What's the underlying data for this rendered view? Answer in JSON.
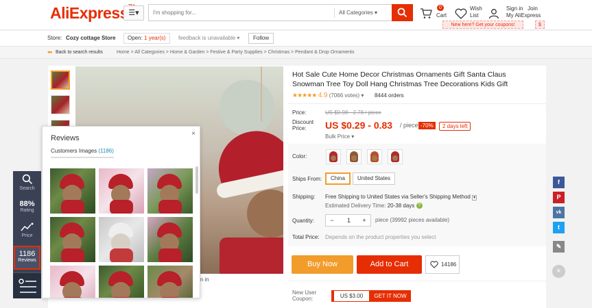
{
  "header": {
    "logo": "AliExpress",
    "logo_tm": "TM",
    "search_placeholder": "I'm shopping for...",
    "search_category": "All Categories",
    "cart_count": "0",
    "cart_label": "Cart",
    "wish_line1": "Wish",
    "wish_line2": "List",
    "signin_line1": "Sign in",
    "signin_line2": "My AliExpress",
    "join": "Join",
    "coupon_tip": "New here? Get your coupons!",
    "coupon_dollar": "$"
  },
  "store": {
    "label": "Store:",
    "name": "Cozy cottage Store",
    "open_label": "Open:",
    "open_value": "1 year(s)",
    "feedback": "feedback is unavailable",
    "follow": "Follow"
  },
  "breadcrumb": {
    "back": "Back to search results",
    "path": "Home > All Categories > Home & Garden > Festive & Party Supplies > Christmas > Pendant & Drop Ornaments"
  },
  "product": {
    "title": "Hot Sale Cute Home Decor Christmas Ornaments Gift Santa Claus Snowman Tree Toy Doll Hang Christmas Tree Decorations Kids Gift",
    "stars": "★★★★★",
    "score": "4.9",
    "votes": "(7066 votes)",
    "orders": "8444 orders",
    "price_label": "Price:",
    "old_price": "US $0.98 - 2.78 / piece",
    "discount_label": "Discount Price:",
    "discount_price": "US $0.29 - 0.83",
    "per_piece": "/ piece",
    "pct_off": "-70%",
    "days_left": "2 days left",
    "bulk_price": "Bulk Price",
    "color_label": "Color:",
    "ships_label": "Ships From:",
    "ships_options": [
      "China",
      "United States"
    ],
    "shipping_label": "Shipping:",
    "shipping_text": "Free Shipping to United States via Seller's Shipping Method",
    "delivery_label": "Estimated Delivery Time:",
    "delivery_value": "20-38 days",
    "quantity_label": "Quantity:",
    "quantity_value": "1",
    "quantity_minus": "−",
    "quantity_plus": "+",
    "quantity_hint": "piece (39992 pieces available)",
    "total_label": "Total Price:",
    "total_hint": "Depends on the product properties you select",
    "buy_now": "Buy Now",
    "add_to_cart": "Add to Cart",
    "wish_count": "14186",
    "new_user_label": "New User Coupon:",
    "coupon_value": "US $3.00",
    "coupon_get": "GET IT NOW",
    "image_caption": "om in"
  },
  "reviews_popup": {
    "title": "Reviews",
    "close": "×",
    "tab_label": "Customers Images",
    "tab_count": "(1186)"
  },
  "sidebar": {
    "search_label": "Search",
    "rating_value": "88%",
    "rating_label": "Rating",
    "price_label": "Price",
    "reviews_value": "1186",
    "reviews_label": "Reviews"
  },
  "share": {
    "facebook": "f",
    "pinterest": "P",
    "vk": "vk",
    "twitter": "t",
    "edit": "✎",
    "close": "×"
  },
  "colors": {
    "brand_red": "#e62e04",
    "orange": "#f29c2b",
    "sidebar_navy": "#3a4155"
  }
}
